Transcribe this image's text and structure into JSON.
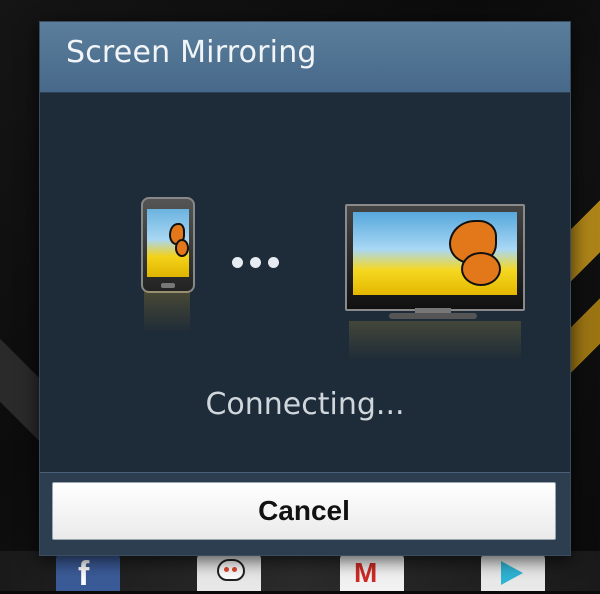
{
  "dialog": {
    "title": "Screen Mirroring",
    "status": "Connecting...",
    "cancel_label": "Cancel"
  },
  "illustration": {
    "source_device_icon": "phone-icon",
    "target_device_icon": "tv-icon",
    "progress_indicator": "three-dots"
  },
  "dock": {
    "apps": [
      {
        "name": "facebook",
        "icon": "facebook-icon"
      },
      {
        "name": "reddit",
        "icon": "reddit-icon"
      },
      {
        "name": "gmail",
        "icon": "gmail-icon"
      },
      {
        "name": "play-store",
        "icon": "play-store-icon"
      }
    ]
  },
  "colors": {
    "header": "#48698a",
    "dialog_body": "#1e2b38",
    "footer": "#2c3e50",
    "button": "#ffffff"
  }
}
